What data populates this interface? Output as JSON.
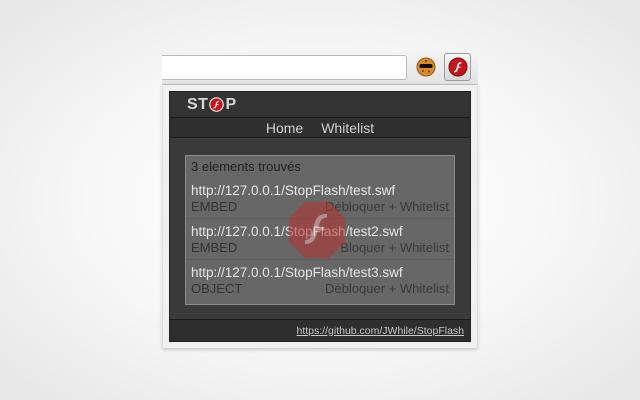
{
  "toolbar": {
    "cookie_icon": "cookie-icon",
    "flash_icon": "flash-icon"
  },
  "popup": {
    "logo": {
      "left": "ST",
      "right": "P",
      "icon": "stop-flash-icon"
    },
    "nav": {
      "home": "Home",
      "whitelist": "Whitelist"
    },
    "count_text": "3 elements trouvés",
    "items": [
      {
        "url": "http://127.0.0.1/StopFlash/test.swf",
        "type": "EMBED",
        "action": "Débloquer",
        "whitelist": "+ Whitelist"
      },
      {
        "url": "http://127.0.0.1/StopFlash/test2.swf",
        "type": "EMBED",
        "action": "Bloquer",
        "whitelist": "+ Whitelist"
      },
      {
        "url": "http://127.0.0.1/StopFlash/test3.swf",
        "type": "OBJECT",
        "action": "Débloquer",
        "whitelist": "+ Whitelist"
      }
    ],
    "footer_link": "https://github.com/JWhile/StopFlash"
  },
  "colors": {
    "accent": "#cc1f1f",
    "popup_bg": "#3a3a3a"
  }
}
